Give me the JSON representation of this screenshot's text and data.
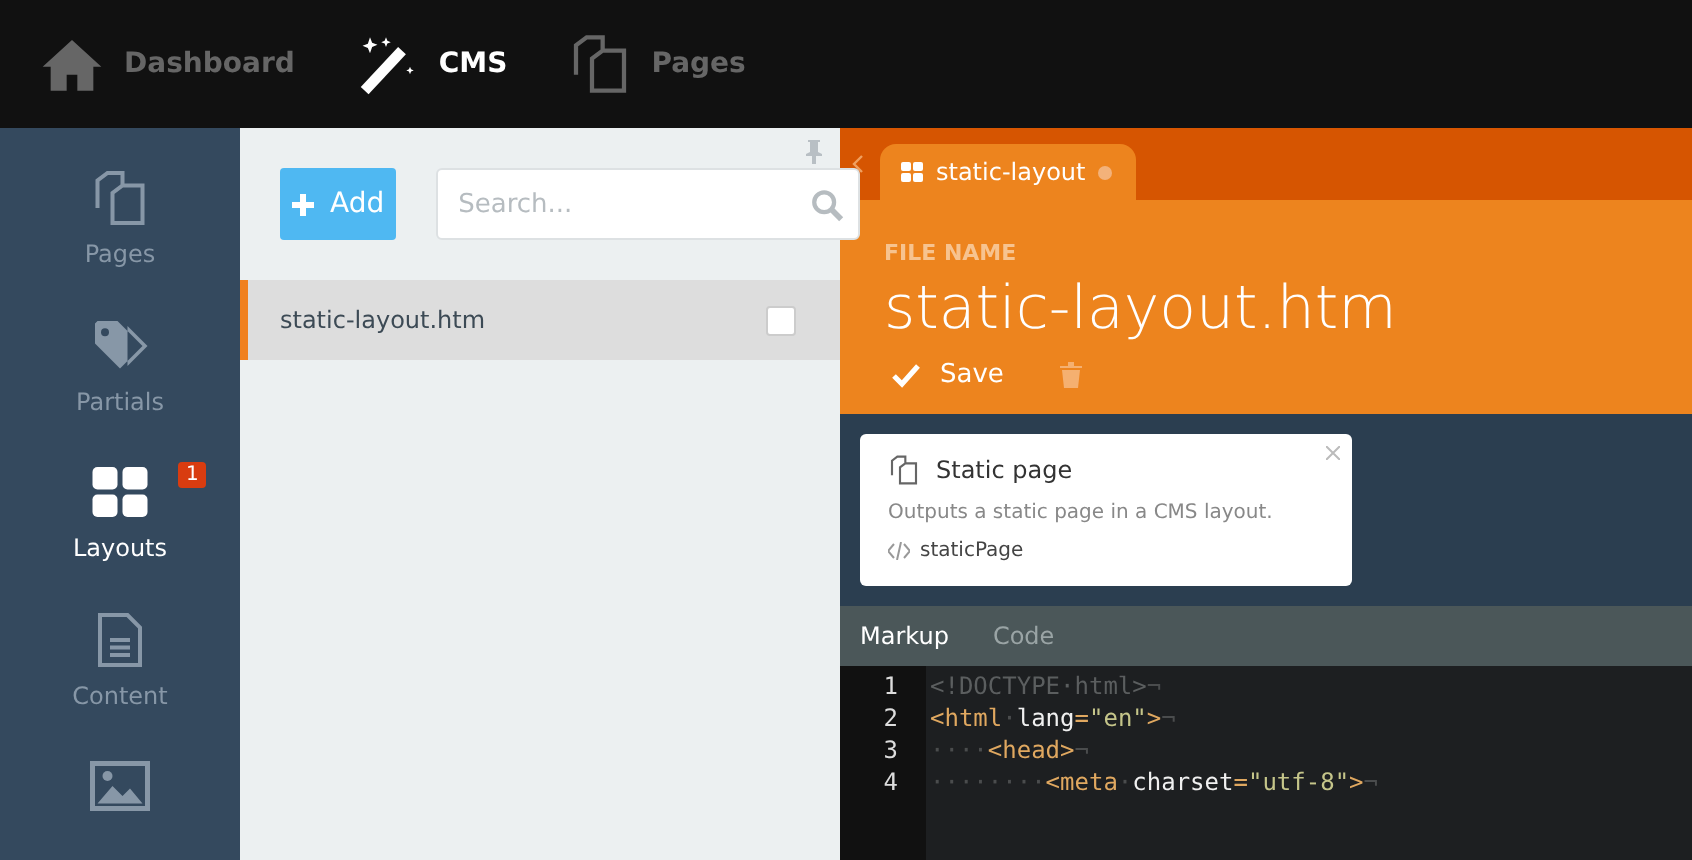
{
  "top_nav": [
    {
      "kind": "home",
      "label": "Dashboard",
      "selected": false
    },
    {
      "kind": "wand",
      "label": "CMS",
      "selected": true
    },
    {
      "kind": "pages",
      "label": "Pages",
      "selected": false
    }
  ],
  "sidebar": {
    "items": [
      {
        "kind": "pages",
        "label": "Pages",
        "selected": false
      },
      {
        "kind": "tag",
        "label": "Partials",
        "selected": false
      },
      {
        "kind": "grid",
        "label": "Layouts",
        "selected": true,
        "badge": "1"
      },
      {
        "kind": "doc",
        "label": "Content",
        "selected": false
      },
      {
        "kind": "image",
        "selected": false
      }
    ]
  },
  "list_panel": {
    "add_button": "Add",
    "search": {
      "placeholder": "Search..."
    },
    "items": [
      {
        "label": "static-layout.htm",
        "selected": true,
        "checked": false
      }
    ]
  },
  "editor": {
    "tab": {
      "label": "static-layout",
      "modified": true
    },
    "file_name_label": "FILE NAME",
    "file_name": "static-layout.htm",
    "save_button": "Save",
    "component": {
      "title": "Static page",
      "description": "Outputs a static page in a CMS layout.",
      "alias": "staticPage"
    },
    "code_tabs": [
      {
        "label": "Markup",
        "selected": true
      },
      {
        "label": "Code",
        "selected": false
      }
    ],
    "code_lines": [
      {
        "number": "1",
        "tokens": [
          {
            "kind": "doctype",
            "text": "<!DOCTYPE·html>"
          },
          {
            "kind": "invis",
            "text": "¬"
          }
        ]
      },
      {
        "number": "2",
        "tokens": [
          {
            "kind": "tag",
            "text": "<html"
          },
          {
            "kind": "invis",
            "text": "·"
          },
          {
            "kind": "attr",
            "text": "lang"
          },
          {
            "kind": "tag",
            "text": "="
          },
          {
            "kind": "string",
            "text": "\"en\""
          },
          {
            "kind": "tag",
            "text": ">"
          },
          {
            "kind": "invis",
            "text": "¬"
          }
        ]
      },
      {
        "number": "3",
        "tokens": [
          {
            "kind": "invis",
            "text": "····"
          },
          {
            "kind": "tag",
            "text": "<head>"
          },
          {
            "kind": "invis",
            "text": "¬"
          }
        ]
      },
      {
        "number": "4",
        "tokens": [
          {
            "kind": "invis",
            "text": "········"
          },
          {
            "kind": "tag",
            "text": "<meta"
          },
          {
            "kind": "invis",
            "text": "·"
          },
          {
            "kind": "attr",
            "text": "charset"
          },
          {
            "kind": "tag",
            "text": "="
          },
          {
            "kind": "string",
            "text": "\"utf-8\""
          },
          {
            "kind": "tag",
            "text": ">"
          },
          {
            "kind": "invis",
            "text": "¬"
          }
        ]
      }
    ]
  }
}
